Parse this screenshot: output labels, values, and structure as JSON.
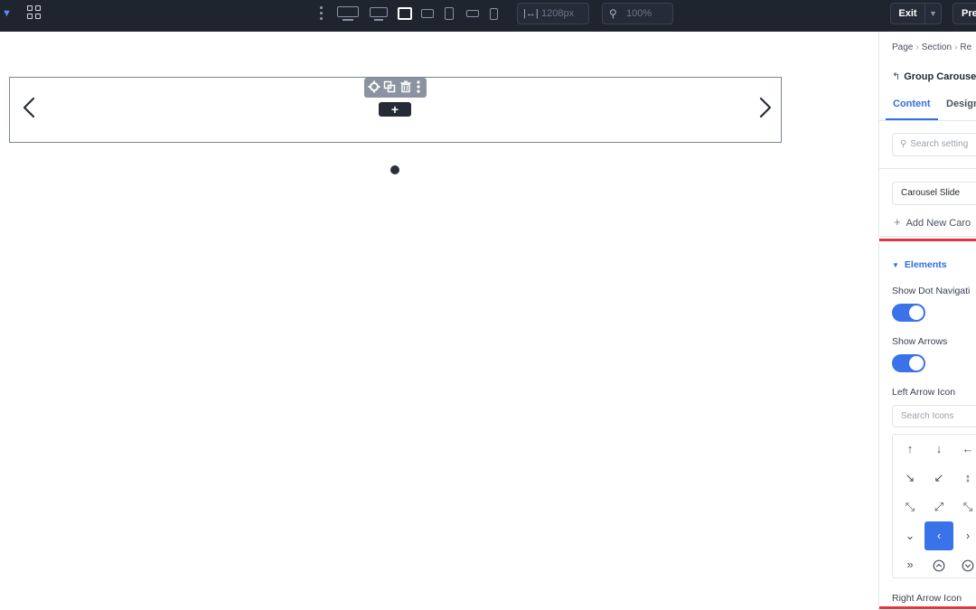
{
  "topbar": {
    "width_value": "1208px",
    "zoom_value": "100%",
    "exit_label": "Exit",
    "preview_label": "Pre",
    "devices": [
      "desktop-large",
      "desktop",
      "laptop",
      "tablet-landscape",
      "tablet",
      "mobile-landscape",
      "mobile"
    ],
    "active_device": "laptop"
  },
  "canvas": {
    "add_label": "+"
  },
  "panel": {
    "breadcrumb": [
      "Page",
      "Section",
      "Re"
    ],
    "group_title": "Group Carousel",
    "tabs": [
      "Content",
      "Design"
    ],
    "search_placeholder": "Search setting",
    "slide_select": "Carousel Slide",
    "add_new_label": "Add New Caro",
    "elements_header": "Elements",
    "show_dot_navigation_label": "Show Dot Navigati",
    "show_dot_navigation_on": true,
    "show_arrows_label": "Show Arrows",
    "show_arrows_on": true,
    "left_arrow_label": "Left Arrow Icon",
    "search_icons_placeholder": "Search Icons",
    "icon_grid": [
      [
        "↑",
        "↓",
        "←"
      ],
      [
        "↘",
        "↙",
        "↕"
      ],
      [
        "⤡",
        "⤢",
        "⤡"
      ],
      [
        "⌄",
        "‹",
        "›"
      ],
      [
        "»",
        "⌃",
        "⌄"
      ]
    ],
    "selected_icon": "‹",
    "right_arrow_label": "Right Arrow Icon"
  },
  "colors": {
    "topbar_bg": "#1f252f",
    "accent": "#3a72ea",
    "highlight": "#e5343b"
  }
}
